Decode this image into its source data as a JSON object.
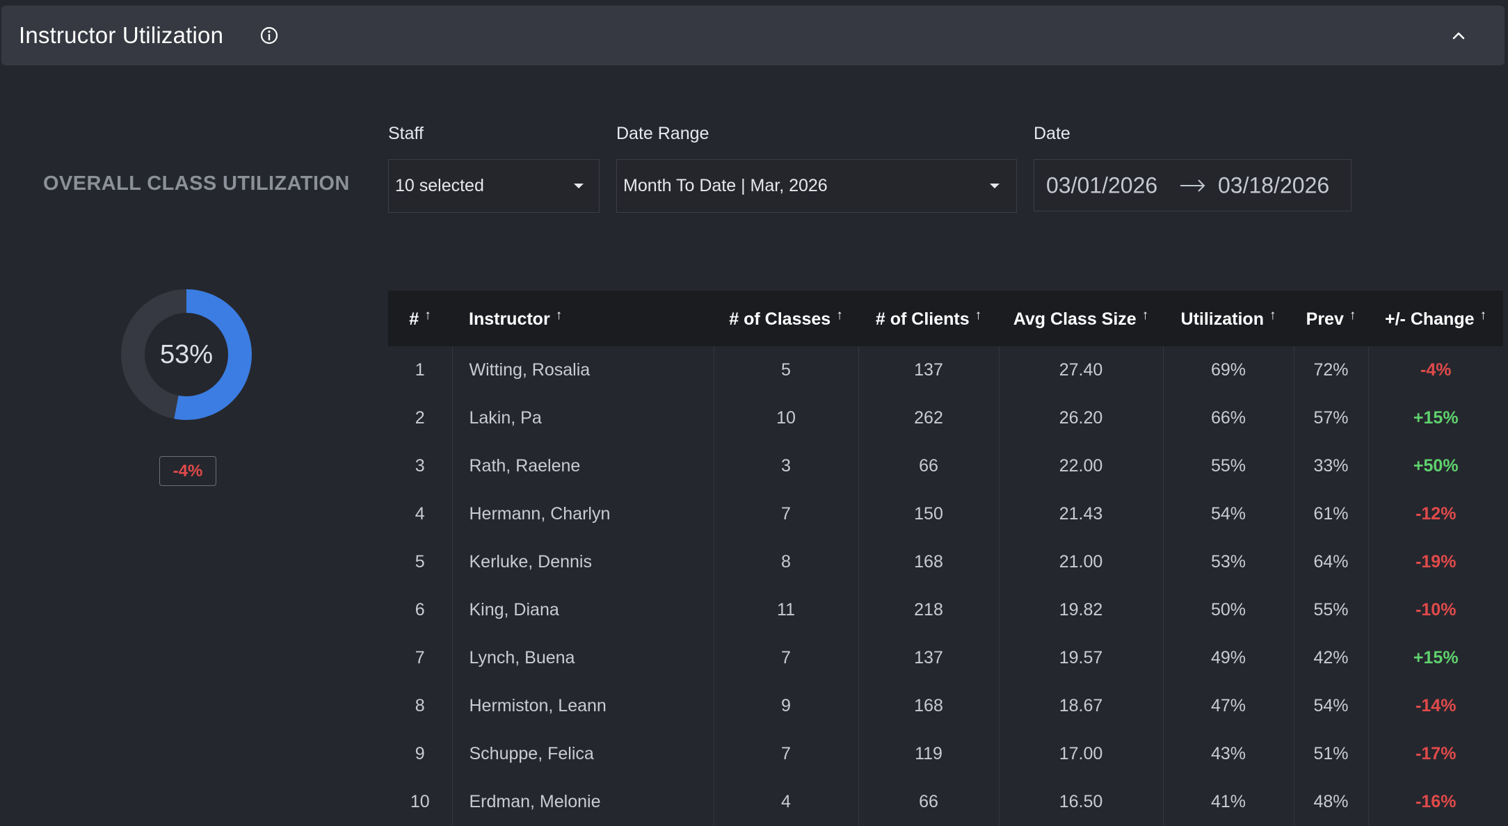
{
  "header": {
    "title": "Instructor Utilization"
  },
  "overall": {
    "label": "OVERALL CLASS UTILIZATION",
    "percent_text": "53%",
    "value": 0.53,
    "change": "-4%"
  },
  "filters": {
    "staff_label": "Staff",
    "staff_value": "10 selected",
    "range_label": "Date Range",
    "range_value": "Month To Date | Mar, 2026",
    "date_label": "Date",
    "date_start": "03/01/2026",
    "date_end": "03/18/2026"
  },
  "colors": {
    "accent": "#3b7de2",
    "negative": "#e04a4a",
    "positive": "#5fd16d"
  },
  "table": {
    "columns": [
      "#",
      "Instructor",
      "# of Classes",
      "# of Clients",
      "Avg Class Size",
      "Utilization",
      "Prev",
      "+/- Change"
    ],
    "sort_glyph": "↑",
    "rows": [
      [
        "1",
        "Witting, Rosalia",
        "5",
        "137",
        "27.40",
        "69%",
        "72%",
        "-4%"
      ],
      [
        "2",
        "Lakin, Pa",
        "10",
        "262",
        "26.20",
        "66%",
        "57%",
        "+15%"
      ],
      [
        "3",
        "Rath, Raelene",
        "3",
        "66",
        "22.00",
        "55%",
        "33%",
        "+50%"
      ],
      [
        "4",
        "Hermann, Charlyn",
        "7",
        "150",
        "21.43",
        "54%",
        "61%",
        "-12%"
      ],
      [
        "5",
        "Kerluke, Dennis",
        "8",
        "168",
        "21.00",
        "53%",
        "64%",
        "-19%"
      ],
      [
        "6",
        "King, Diana",
        "11",
        "218",
        "19.82",
        "50%",
        "55%",
        "-10%"
      ],
      [
        "7",
        "Lynch, Buena",
        "7",
        "137",
        "19.57",
        "49%",
        "42%",
        "+15%"
      ],
      [
        "8",
        "Hermiston, Leann",
        "9",
        "168",
        "18.67",
        "47%",
        "54%",
        "-14%"
      ],
      [
        "9",
        "Schuppe, Felica",
        "7",
        "119",
        "17.00",
        "43%",
        "51%",
        "-17%"
      ],
      [
        "10",
        "Erdman, Melonie",
        "4",
        "66",
        "16.50",
        "41%",
        "48%",
        "-16%"
      ]
    ]
  }
}
